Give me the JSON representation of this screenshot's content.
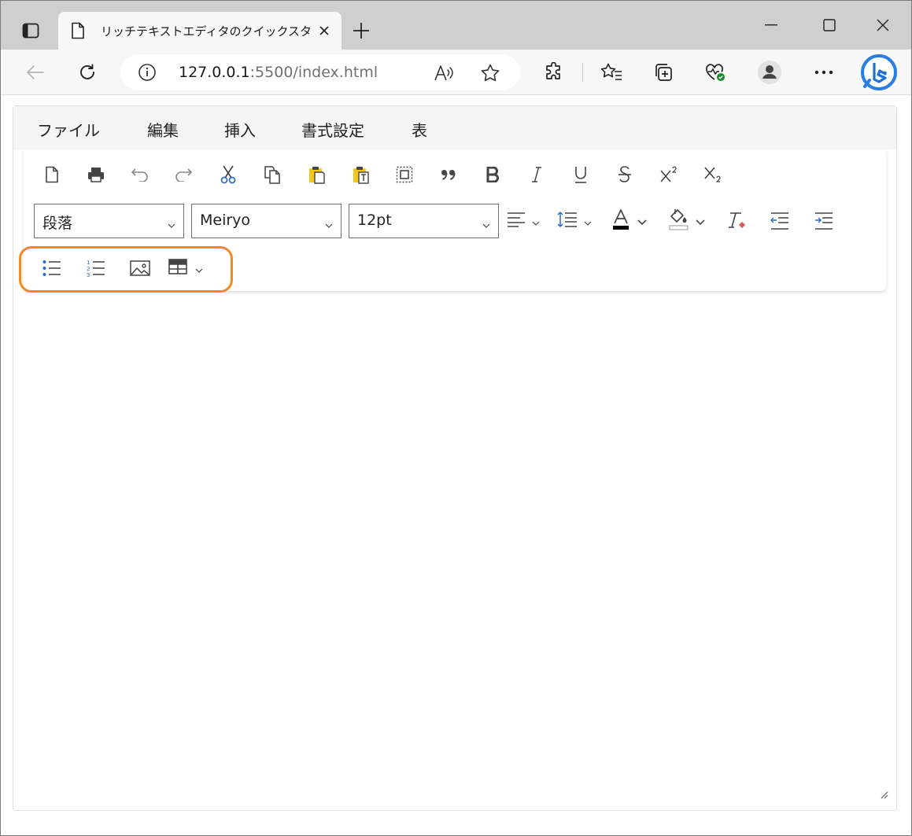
{
  "browser": {
    "tab_title": "リッチテキストエディタのクイックスタート",
    "url_host": "127.0.0.1",
    "url_rest": ":5500/index.html"
  },
  "editor": {
    "menu": [
      "ファイル",
      "編集",
      "挿入",
      "書式設定",
      "表"
    ],
    "format_select": "段落",
    "font_select": "Meiryo",
    "size_select": "12pt",
    "toolbar_row1": [
      "new-document",
      "print",
      "undo",
      "redo",
      "cut",
      "copy",
      "paste",
      "paste-text",
      "select-all",
      "blockquote",
      "bold",
      "italic",
      "underline",
      "strikethrough",
      "superscript",
      "subscript"
    ],
    "toolbar_row3": [
      "bulleted-list",
      "numbered-list",
      "insert-image",
      "insert-table"
    ],
    "highlight_color": "#f28a22",
    "font_color": "#000000",
    "clear_format_color": "#e05555"
  }
}
